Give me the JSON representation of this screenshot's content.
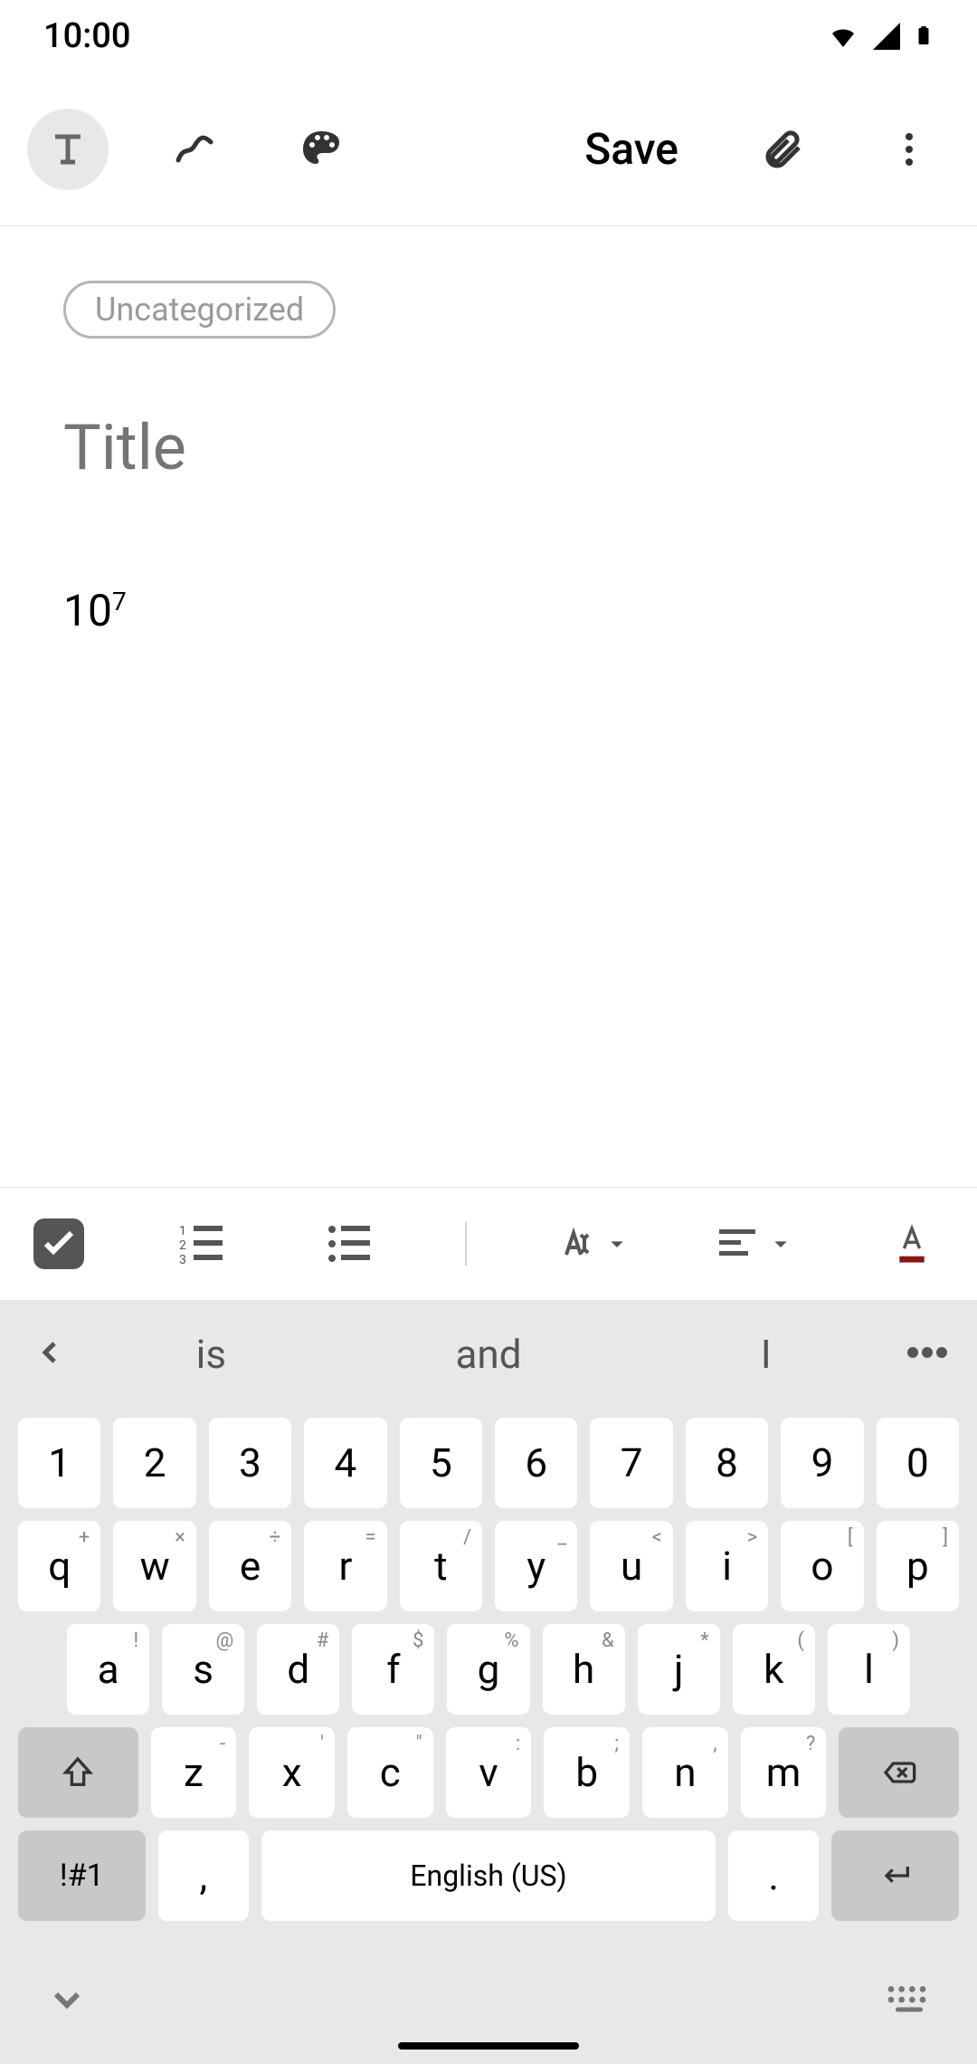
{
  "status": {
    "time": "10:00"
  },
  "toolbar": {
    "save_label": "Save"
  },
  "editor": {
    "category": "Uncategorized",
    "title_placeholder": "Title",
    "body_base": "10",
    "body_sup": "7"
  },
  "suggestions": {
    "word1": "is",
    "word2": "and",
    "word3": "I"
  },
  "keyboard": {
    "row1": [
      "1",
      "2",
      "3",
      "4",
      "5",
      "6",
      "7",
      "8",
      "9",
      "0"
    ],
    "row2": [
      {
        "main": "q",
        "alt": "+"
      },
      {
        "main": "w",
        "alt": "×"
      },
      {
        "main": "e",
        "alt": "÷"
      },
      {
        "main": "r",
        "alt": "="
      },
      {
        "main": "t",
        "alt": "/"
      },
      {
        "main": "y",
        "alt": "_"
      },
      {
        "main": "u",
        "alt": "<"
      },
      {
        "main": "i",
        "alt": ">"
      },
      {
        "main": "o",
        "alt": "["
      },
      {
        "main": "p",
        "alt": "]"
      }
    ],
    "row3": [
      {
        "main": "a",
        "alt": "!"
      },
      {
        "main": "s",
        "alt": "@"
      },
      {
        "main": "d",
        "alt": "#"
      },
      {
        "main": "f",
        "alt": "$"
      },
      {
        "main": "g",
        "alt": "%"
      },
      {
        "main": "h",
        "alt": "&"
      },
      {
        "main": "j",
        "alt": "*"
      },
      {
        "main": "k",
        "alt": "("
      },
      {
        "main": "l",
        "alt": ")"
      }
    ],
    "row4": [
      {
        "main": "z",
        "alt": "-"
      },
      {
        "main": "x",
        "alt": "'"
      },
      {
        "main": "c",
        "alt": "\""
      },
      {
        "main": "v",
        "alt": ":"
      },
      {
        "main": "b",
        "alt": ";"
      },
      {
        "main": "n",
        "alt": ","
      },
      {
        "main": "m",
        "alt": "?"
      }
    ],
    "sym_label": "!#1",
    "comma": ",",
    "space_label": "English (US)",
    "period": "."
  }
}
